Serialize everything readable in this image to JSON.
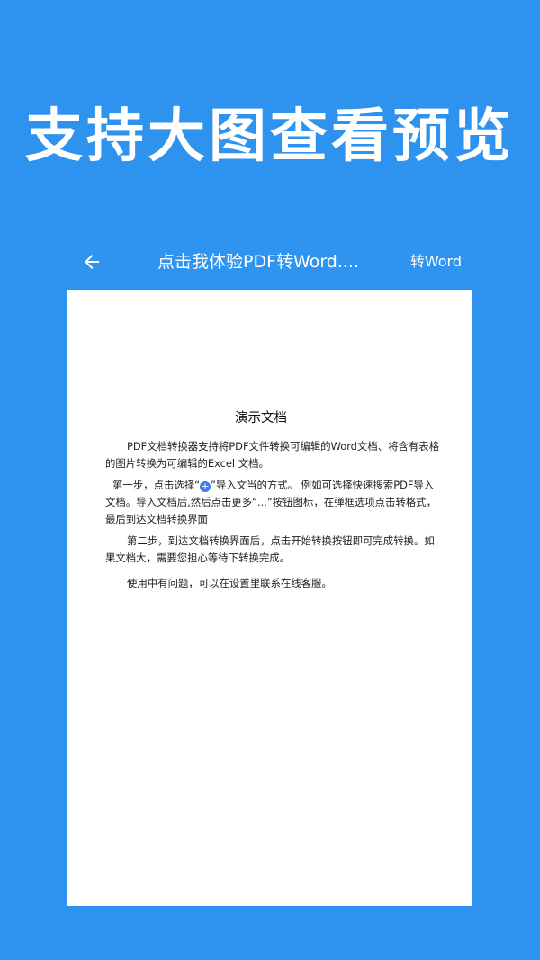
{
  "promo": {
    "headline": "支持大图查看预览"
  },
  "appbar": {
    "back_icon": "arrow-left-icon",
    "title": "点击我体验PDF转Word....",
    "action_label": "转Word"
  },
  "document": {
    "title": "演示文档",
    "paragraph1": "PDF文档转换器支持将PDF文件转换可编辑的Word文档、将含有表格的图片转换为可编辑的Excel 文档。",
    "paragraph2_before": "第一步，点击选择“",
    "paragraph2_icon": "plus-circle-icon",
    "paragraph2_icon_glyph": "+",
    "paragraph2_after": "”导入文当的方式。 例如可选择快速搜索PDF导入文档。导入文档后,然后点击更多“...”按钮图标，在弹框选项点击转格式，最后到达文档转换界面",
    "paragraph3": "第二步，到达文档转换界面后，点击开始转换按钮即可完成转换。如果文档大，需要您担心等待下转换完成。",
    "paragraph4": "使用中有问题，可以在设置里联系在线客服。"
  },
  "colors": {
    "background": "#2d93ee",
    "appbar": "#2f94ef",
    "icon_accent": "#3a7ee8"
  }
}
